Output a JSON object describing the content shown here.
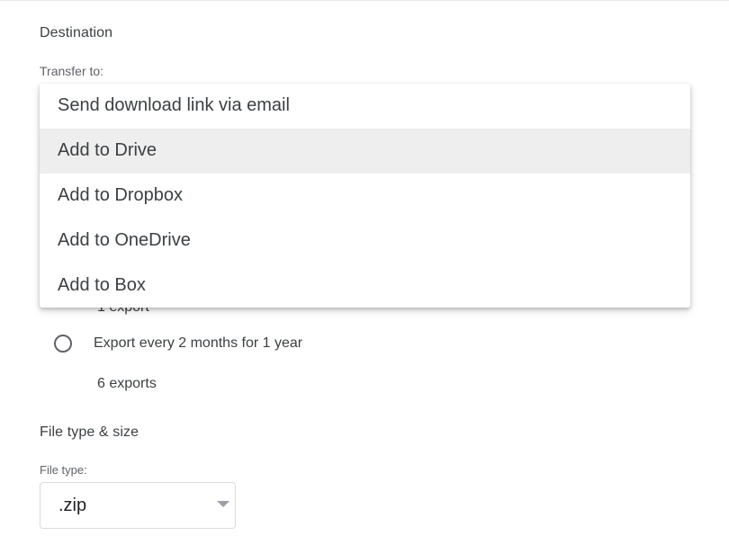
{
  "destination": {
    "heading": "Destination",
    "transfer_label": "Transfer to:",
    "menu_items": [
      {
        "label": "Send download link via email",
        "highlighted": false
      },
      {
        "label": "Add to Drive",
        "highlighted": true
      },
      {
        "label": "Add to Dropbox",
        "highlighted": false
      },
      {
        "label": "Add to OneDrive",
        "highlighted": false
      },
      {
        "label": "Add to Box",
        "highlighted": false
      }
    ]
  },
  "frequency": {
    "partial_count": "1 export",
    "options": [
      {
        "label": "Export every 2 months for 1 year",
        "sub": "6 exports",
        "selected": false
      }
    ]
  },
  "file_type_size": {
    "heading": "File type & size",
    "file_type_label": "File type:",
    "file_type_value": ".zip"
  },
  "colors": {
    "menu_highlight": "#eeeeee",
    "text": "#3c4043",
    "border": "#dadce0"
  }
}
